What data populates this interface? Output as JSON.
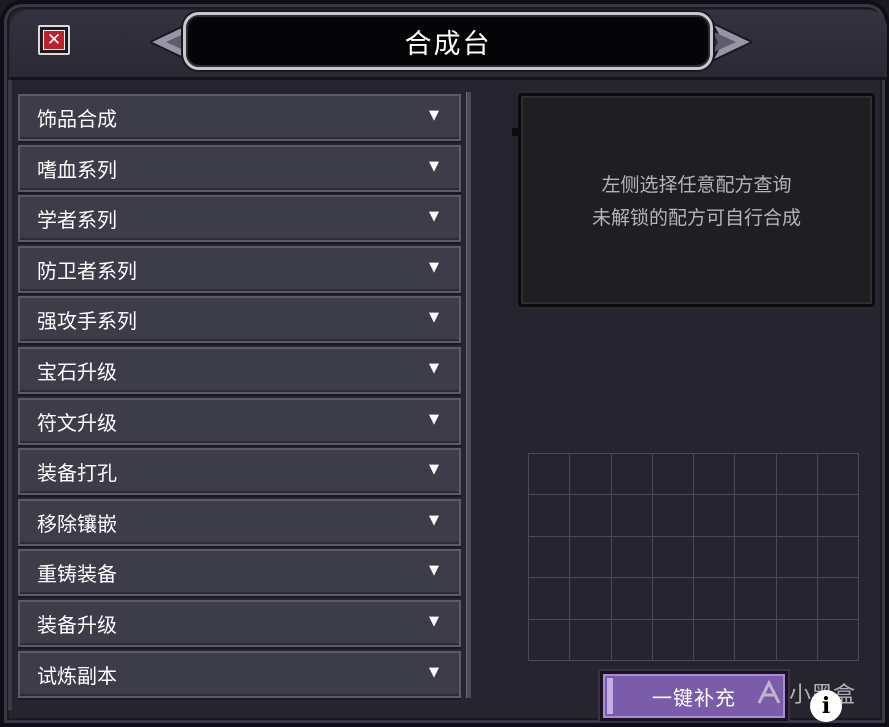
{
  "window": {
    "title": "合成台",
    "close_glyph": "✕"
  },
  "categories": [
    {
      "label": "饰品合成",
      "arrow": "▼"
    },
    {
      "label": "嗜血系列",
      "arrow": "▼"
    },
    {
      "label": "学者系列",
      "arrow": "▼"
    },
    {
      "label": "防卫者系列",
      "arrow": "▼"
    },
    {
      "label": "强攻手系列",
      "arrow": "▼"
    },
    {
      "label": "宝石升级",
      "arrow": "▼"
    },
    {
      "label": "符文升级",
      "arrow": "▼"
    },
    {
      "label": "装备打孔",
      "arrow": "▼"
    },
    {
      "label": "移除镶嵌",
      "arrow": "▼"
    },
    {
      "label": "重铸装备",
      "arrow": "▼"
    },
    {
      "label": "装备升级",
      "arrow": "▼"
    },
    {
      "label": "试炼副本",
      "arrow": "▼"
    }
  ],
  "info": {
    "line1": "左侧选择任意配方查询",
    "line2": "未解锁的配方可自行合成"
  },
  "refill_button": {
    "label": "一键补充"
  },
  "watermark": {
    "text": "小黑盒",
    "info_glyph": "i"
  },
  "colors": {
    "accent_purple": "#7b5cab",
    "close_red": "#c0202a",
    "panel_bg": "#26252f"
  }
}
